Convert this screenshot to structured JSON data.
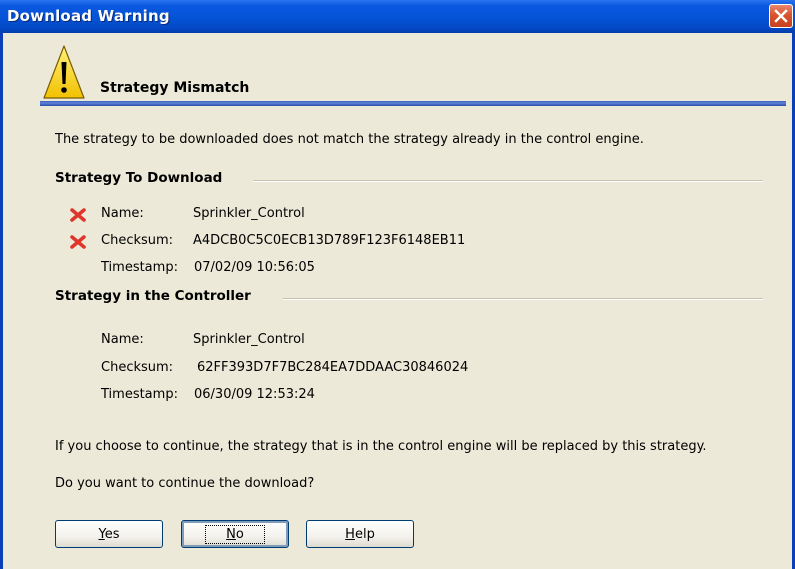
{
  "window": {
    "title": "Download Warning"
  },
  "header": {
    "heading": "Strategy Mismatch"
  },
  "intro": "The strategy to be downloaded does not match the strategy already in the control engine.",
  "to_download": {
    "title": "Strategy To Download",
    "rows": [
      {
        "label": "Name:",
        "value": "Sprinkler_Control",
        "mismatch": true
      },
      {
        "label": "Checksum:",
        "value": "A4DCB0C5C0ECB13D789F123F6148EB11",
        "mismatch": true
      },
      {
        "label": "Timestamp:",
        "value": "07/02/09 10:56:05",
        "mismatch": false
      }
    ]
  },
  "in_controller": {
    "title": "Strategy in the Controller",
    "rows": [
      {
        "label": "Name:",
        "value": "Sprinkler_Control"
      },
      {
        "label": "Checksum:",
        "value": "62FF393D7F7BC284EA7DDAAC30846024"
      },
      {
        "label": "Timestamp:",
        "value": "06/30/09 12:53:24"
      }
    ]
  },
  "notice": "If you choose to continue, the strategy that is in the control engine will be replaced by this strategy.",
  "question": "Do you want to continue the download?",
  "buttons": {
    "yes": {
      "mnemonic": "Y",
      "rest": "es"
    },
    "no": {
      "mnemonic": "N",
      "rest": "o"
    },
    "help": {
      "mnemonic": "H",
      "rest": "elp"
    }
  },
  "icons": {
    "close": "close-icon",
    "warning": "warning-icon",
    "mismatch": "mismatch-x-icon"
  },
  "colors": {
    "titlebar": "#0453d6",
    "dialog_bg": "#ece9d8",
    "mismatch_x": "#e0352b"
  }
}
